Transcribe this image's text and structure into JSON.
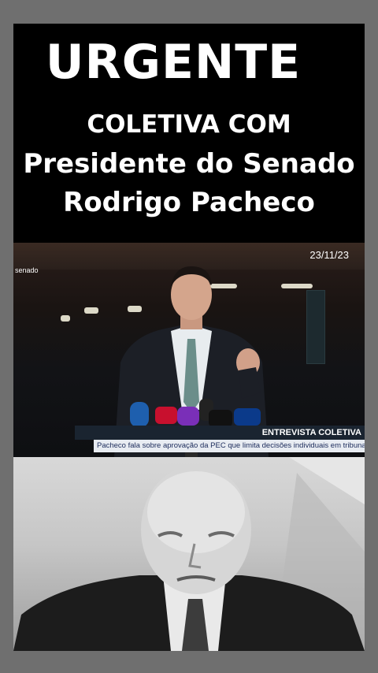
{
  "headline": {
    "line1": "URGENTE",
    "line2": "COLETIVA  COM",
    "line3": "Presidente do Senado",
    "line4": "Rodrigo Pacheco"
  },
  "video": {
    "channel_logo": "senado",
    "date": "23/11/23",
    "lower_third_title": "ENTREVISTA COLETIVA",
    "ticker_text": "Pacheco fala sobre aprovação da PEC que limita decisões individuais em tribunais"
  },
  "colors": {
    "frame_background": "#000000",
    "outer_background": "#6f6f6f",
    "headline_text": "#ffffff"
  }
}
